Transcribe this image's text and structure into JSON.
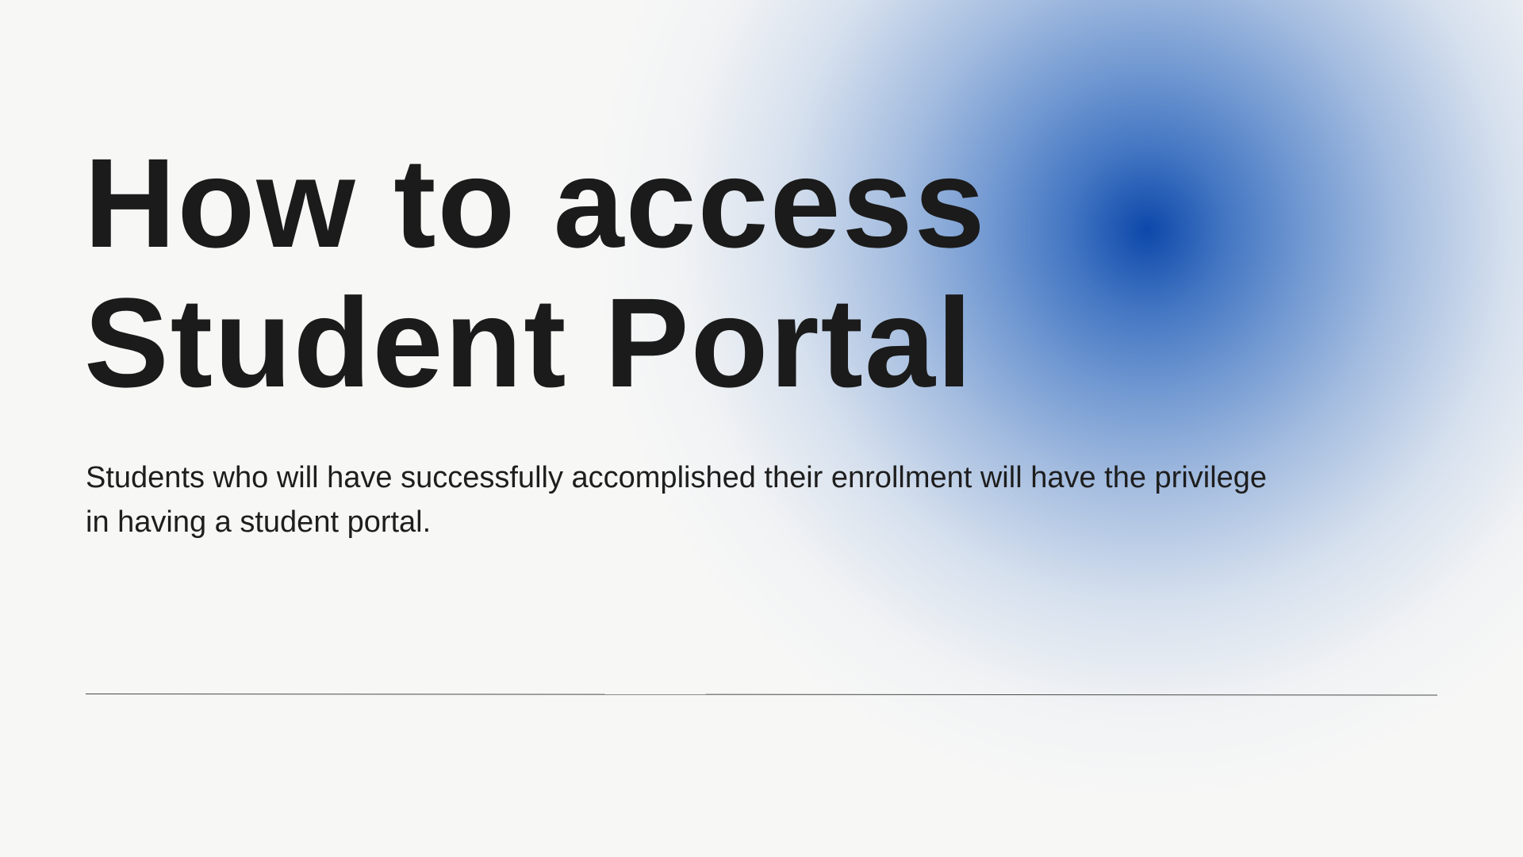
{
  "slide": {
    "title_lines": [
      "How to access",
      "Student Portal"
    ],
    "body_lines": [
      "Students who will have successfully accomplished their enrollment will have the privilege",
      "in having a student portal."
    ],
    "colors": {
      "background": "#f7f7f6",
      "accent_glow": "#0d48aa",
      "text": "#1b1b1b"
    }
  }
}
